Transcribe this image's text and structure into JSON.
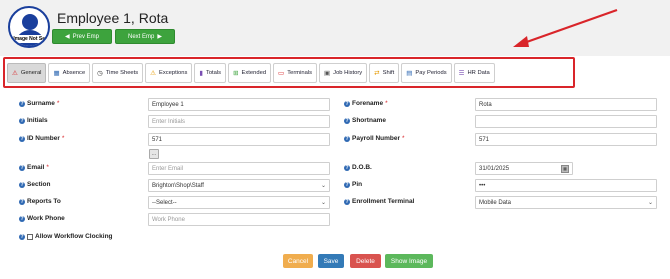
{
  "header": {
    "title": "Employee 1, Rota",
    "avatar_caption": "Image Not Set",
    "prev_label": "Prev Emp",
    "next_label": "Next Emp"
  },
  "tabs": [
    {
      "label": "General",
      "icon": "warning-icon"
    },
    {
      "label": "Absence",
      "icon": "calendar-icon"
    },
    {
      "label": "Time Sheets",
      "icon": "clock-icon"
    },
    {
      "label": "Exceptions",
      "icon": "warning-icon"
    },
    {
      "label": "Totals",
      "icon": "bar-chart-icon"
    },
    {
      "label": "Extended",
      "icon": "plus-square-icon"
    },
    {
      "label": "Terminals",
      "icon": "monitor-icon"
    },
    {
      "label": "Job History",
      "icon": "briefcase-icon"
    },
    {
      "label": "Shift",
      "icon": "exchange-icon"
    },
    {
      "label": "Pay Periods",
      "icon": "calendar-range-icon"
    },
    {
      "label": "HR Data",
      "icon": "list-icon"
    }
  ],
  "form": {
    "surname": {
      "label": "Surname",
      "value": "Employee 1"
    },
    "forename": {
      "label": "Forename",
      "value": "Rota"
    },
    "initials": {
      "label": "Initials",
      "placeholder": "Enter Initials"
    },
    "shortname": {
      "label": "Shortname",
      "value": ""
    },
    "id_number": {
      "label": "ID Number",
      "value": "571",
      "button": "..."
    },
    "payroll_number": {
      "label": "Payroll Number",
      "value": "571"
    },
    "email": {
      "label": "Email",
      "placeholder": "Enter Email"
    },
    "dob": {
      "label": "D.O.B.",
      "value": "31/01/2025"
    },
    "section": {
      "label": "Section",
      "value": "Brighton\\Shop\\Staff"
    },
    "pin": {
      "label": "Pin",
      "value": "•••"
    },
    "reports_to": {
      "label": "Reports To",
      "value": "--Select--"
    },
    "enrollment_terminal": {
      "label": "Enrollment Terminal",
      "value": "Mobile Data"
    },
    "work_phone": {
      "label": "Work Phone",
      "placeholder": "Work Phone"
    },
    "allow_workflow": {
      "label": "Allow Workflow Clocking"
    }
  },
  "actions": {
    "cancel": "Cancel",
    "save": "Save",
    "delete": "Delete",
    "show_image": "Show Image"
  },
  "colors": {
    "accent_red": "#d9252a",
    "green": "#3da33d",
    "blue": "#337ab7",
    "orange": "#f0ad4e"
  }
}
